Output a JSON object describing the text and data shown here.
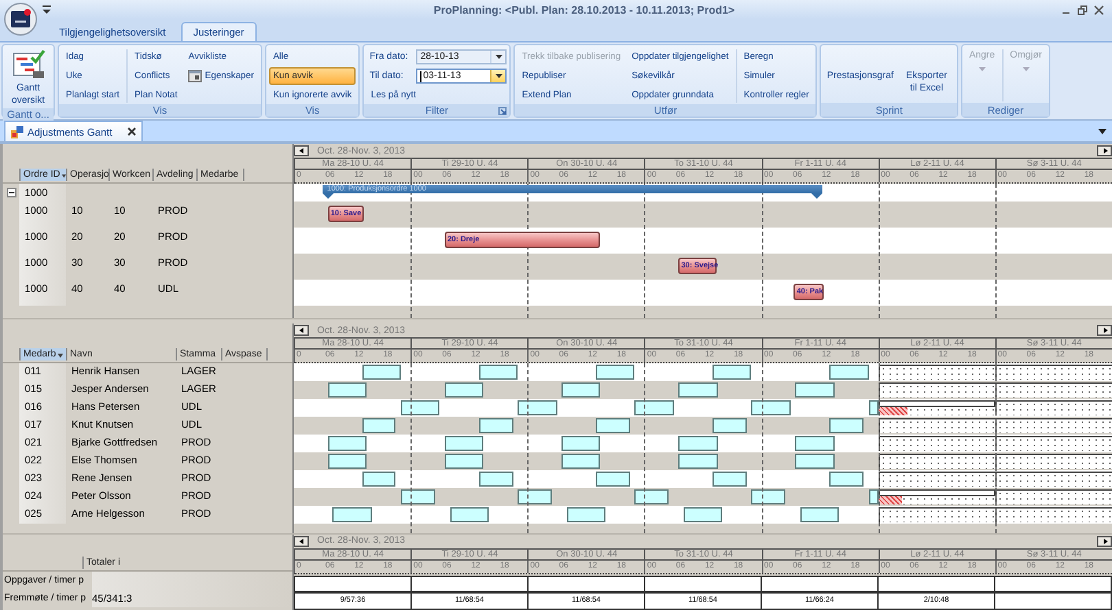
{
  "window": {
    "title": "ProPlanning: <Publ. Plan: 28.10.2013 - 10.11.2013; Prod1>"
  },
  "ribbon": {
    "tabs": [
      {
        "label": "Tilgjengelighetsoversikt",
        "selected": false
      },
      {
        "label": "Justeringer",
        "selected": true
      }
    ],
    "groups": [
      {
        "label": "Gantt o...",
        "launcher": false,
        "columns": [
          {
            "separator": false,
            "items": [
              {
                "kind": "large",
                "label": "Gantt oversikt",
                "disabled": false
              }
            ]
          }
        ]
      },
      {
        "label": "Vis",
        "launcher": false,
        "columns": [
          {
            "separator": false,
            "items": [
              {
                "kind": "text",
                "label": "Idag",
                "disabled": false
              },
              {
                "kind": "text",
                "label": "Uke",
                "disabled": false
              },
              {
                "kind": "text",
                "label": "Planlagt start",
                "disabled": false
              }
            ]
          },
          {
            "separator": true,
            "items": [
              {
                "kind": "text",
                "label": "Tidskø",
                "disabled": false
              },
              {
                "kind": "text",
                "label": "Conflicts",
                "disabled": false
              },
              {
                "kind": "text",
                "label": "Plan Notat",
                "disabled": false
              }
            ]
          },
          {
            "separator": false,
            "items": [
              {
                "kind": "text",
                "label": "Avvikliste",
                "disabled": false
              },
              {
                "kind": "icon_text",
                "label": "Egenskaper",
                "disabled": false
              }
            ]
          }
        ]
      },
      {
        "label": "Vis",
        "launcher": false,
        "columns": [
          {
            "separator": false,
            "items": [
              {
                "kind": "toggle",
                "label": "Alle",
                "selected": false,
                "disabled": false
              },
              {
                "kind": "toggle",
                "label": "Kun avvik",
                "selected": true,
                "disabled": false
              },
              {
                "kind": "toggle",
                "label": "Kun ignorerte avvik",
                "selected": false,
                "disabled": false
              }
            ]
          }
        ]
      },
      {
        "label": "Filter",
        "launcher": true,
        "columns": [
          {
            "separator": false,
            "items": [
              {
                "kind": "date",
                "label": "Fra dato:",
                "value": "28-10-13",
                "focused": false,
                "disabled": false
              },
              {
                "kind": "date",
                "label": "Til dato:",
                "value": "03-11-13",
                "focused": true,
                "disabled": false
              },
              {
                "kind": "text",
                "label": "Les på nytt",
                "disabled": false
              }
            ]
          }
        ]
      },
      {
        "label": "Utfør",
        "launcher": false,
        "columns": [
          {
            "separator": false,
            "items": [
              {
                "kind": "text",
                "label": "Trekk tilbake publisering",
                "disabled": true
              },
              {
                "kind": "text",
                "label": "Republiser",
                "disabled": false
              },
              {
                "kind": "text",
                "label": "Extend Plan",
                "disabled": false
              }
            ]
          },
          {
            "separator": false,
            "items": [
              {
                "kind": "text",
                "label": "Oppdater tilgjengelighet",
                "disabled": false
              },
              {
                "kind": "text",
                "label": "Søkevilkår",
                "disabled": false
              },
              {
                "kind": "text",
                "label": "Oppdater grunndata",
                "disabled": false
              }
            ]
          },
          {
            "separator": true,
            "items": [
              {
                "kind": "text",
                "label": "Beregn",
                "disabled": false
              },
              {
                "kind": "text",
                "label": "Simuler",
                "disabled": false
              },
              {
                "kind": "text",
                "label": "Kontroller regler",
                "disabled": false
              }
            ]
          }
        ]
      },
      {
        "label": "Sprint",
        "launcher": false,
        "columns": [
          {
            "separator": false,
            "items": [
              {
                "kind": "large_text",
                "label": "Prestasjonsgraf",
                "disabled": false
              }
            ]
          },
          {
            "separator": false,
            "items": [
              {
                "kind": "large_text",
                "label": "Eksporter til Excel",
                "disabled": false
              }
            ]
          }
        ]
      },
      {
        "label": "Rediger",
        "launcher": false,
        "columns": [
          {
            "separator": false,
            "items": [
              {
                "kind": "split",
                "label": "Angre",
                "disabled": true
              }
            ]
          },
          {
            "separator": true,
            "items": [
              {
                "kind": "split",
                "label": "Omgjør",
                "disabled": true
              }
            ]
          }
        ]
      }
    ]
  },
  "doc_tabs": [
    {
      "label": "Adjustments Gantt",
      "selected": true
    }
  ],
  "orders": {
    "timeline": {
      "range": "Oct. 28-Nov. 3, 2013",
      "days": [
        "Ma 28-10 U. 44",
        "Ti 29-10 U. 44",
        "On 30-10 U. 44",
        "To 31-10 U. 44",
        "Fr 1-11 U. 44",
        "Lø 2-11 U. 44",
        "Sø 3-11 U. 44"
      ],
      "hours": [
        "0",
        "06",
        "12",
        "18",
        "00",
        "06",
        "12",
        "18",
        "00",
        "06",
        "12",
        "18",
        "00",
        "06",
        "12",
        "18",
        "00",
        "06",
        "12",
        "18",
        "00",
        "06",
        "12",
        "18",
        "00",
        "06",
        "12",
        "18"
      ]
    },
    "columns": [
      {
        "label": "Ordre ID",
        "sorted": true
      },
      {
        "label": "Operasjo",
        "sorted": false
      },
      {
        "label": "Workcen",
        "sorted": false
      },
      {
        "label": "Avdeling",
        "sorted": false
      },
      {
        "label": "Medarbe",
        "sorted": false
      }
    ],
    "rows": [
      {
        "kind": "summary",
        "expanded": true,
        "cells": [
          "1000"
        ],
        "bar": {
          "label": "1000: Produksjonsordre 1000"
        }
      },
      {
        "kind": "operation",
        "cells": [
          "1000",
          "10",
          "10",
          "PROD"
        ],
        "bar": {
          "label": "10: Save"
        }
      },
      {
        "kind": "operation",
        "cells": [
          "1000",
          "20",
          "20",
          "PROD"
        ],
        "bar": {
          "label": "20: Dreje"
        }
      },
      {
        "kind": "operation",
        "cells": [
          "1000",
          "30",
          "30",
          "PROD"
        ],
        "bar": {
          "label": "30: Svejse"
        }
      },
      {
        "kind": "operation",
        "cells": [
          "1000",
          "40",
          "40",
          "UDL"
        ],
        "bar": {
          "label": "40: Pak"
        }
      }
    ]
  },
  "staff": {
    "timeline": {
      "range": "Oct. 28-Nov. 3, 2013",
      "days": [
        {
          "label": "Ma 28-10 U. 44",
          "weekend": false
        },
        {
          "label": "Ti 29-10 U. 44",
          "weekend": false
        },
        {
          "label": "On 30-10 U. 44",
          "weekend": false
        },
        {
          "label": "To 31-10 U. 44",
          "weekend": false
        },
        {
          "label": "Fr 1-11 U. 44",
          "weekend": false
        },
        {
          "label": "Lø 2-11 U. 44",
          "weekend": true
        },
        {
          "label": "Sø 3-11 U. 44",
          "weekend": true
        }
      ],
      "hours": [
        "0",
        "06",
        "12",
        "18",
        "00",
        "06",
        "12",
        "18",
        "00",
        "06",
        "12",
        "18",
        "00",
        "06",
        "12",
        "18",
        "00",
        "06",
        "12",
        "18",
        "00",
        "06",
        "12",
        "18",
        "00",
        "06",
        "12",
        "18"
      ]
    },
    "columns": [
      {
        "label": "Medarb",
        "sorted": true
      },
      {
        "label": "Navn",
        "sorted": false
      },
      {
        "label": "Stamma",
        "sorted": false
      },
      {
        "label": "Avspase",
        "sorted": false
      }
    ],
    "rows": [
      {
        "cells": [
          "011",
          "Henrik Hansen",
          "LAGER"
        ],
        "conflict": false
      },
      {
        "cells": [
          "015",
          "Jesper Andersen",
          "LAGER"
        ],
        "conflict": false
      },
      {
        "cells": [
          "016",
          "Hans Petersen",
          "UDL"
        ],
        "conflict": true
      },
      {
        "cells": [
          "017",
          "Knut Knutsen",
          "UDL"
        ],
        "conflict": false
      },
      {
        "cells": [
          "021",
          "Bjarke Gottfredsen",
          "PROD"
        ],
        "conflict": false
      },
      {
        "cells": [
          "022",
          "Else Thomsen",
          "PROD"
        ],
        "conflict": false
      },
      {
        "cells": [
          "023",
          "Rene Jensen",
          "PROD"
        ],
        "conflict": false
      },
      {
        "cells": [
          "024",
          "Peter Olsson",
          "PROD"
        ],
        "conflict": true
      },
      {
        "cells": [
          "025",
          "Arne Helgesson",
          "PROD"
        ],
        "conflict": false
      }
    ]
  },
  "totals": {
    "timeline": {
      "range": "Oct. 28-Nov. 3, 2013",
      "days": [
        "Ma 28-10 U. 44",
        "Ti 29-10 U. 44",
        "On 30-10 U. 44",
        "To 31-10 U. 44",
        "Fr 1-11 U. 44",
        "Lø 2-11 U. 44",
        "Sø 3-11 U. 44"
      ],
      "hours": [
        "0",
        "06",
        "12",
        "18",
        "00",
        "06",
        "12",
        "18",
        "00",
        "06",
        "12",
        "18",
        "00",
        "06",
        "12",
        "18",
        "00",
        "06",
        "12",
        "18",
        "00",
        "06",
        "12",
        "18",
        "00",
        "06",
        "12",
        "18"
      ]
    },
    "columns": [
      {
        "label": "Totaler i"
      }
    ],
    "rows": [
      {
        "label": "Oppgaver / timer p"
      },
      {
        "label": "Fremmøte / timer p",
        "total": "45/341:3",
        "days": [
          "9/57:36",
          "11/68:54",
          "11/68:54",
          "11/68:54",
          "11/66:24",
          "2/10:48"
        ]
      }
    ]
  }
}
